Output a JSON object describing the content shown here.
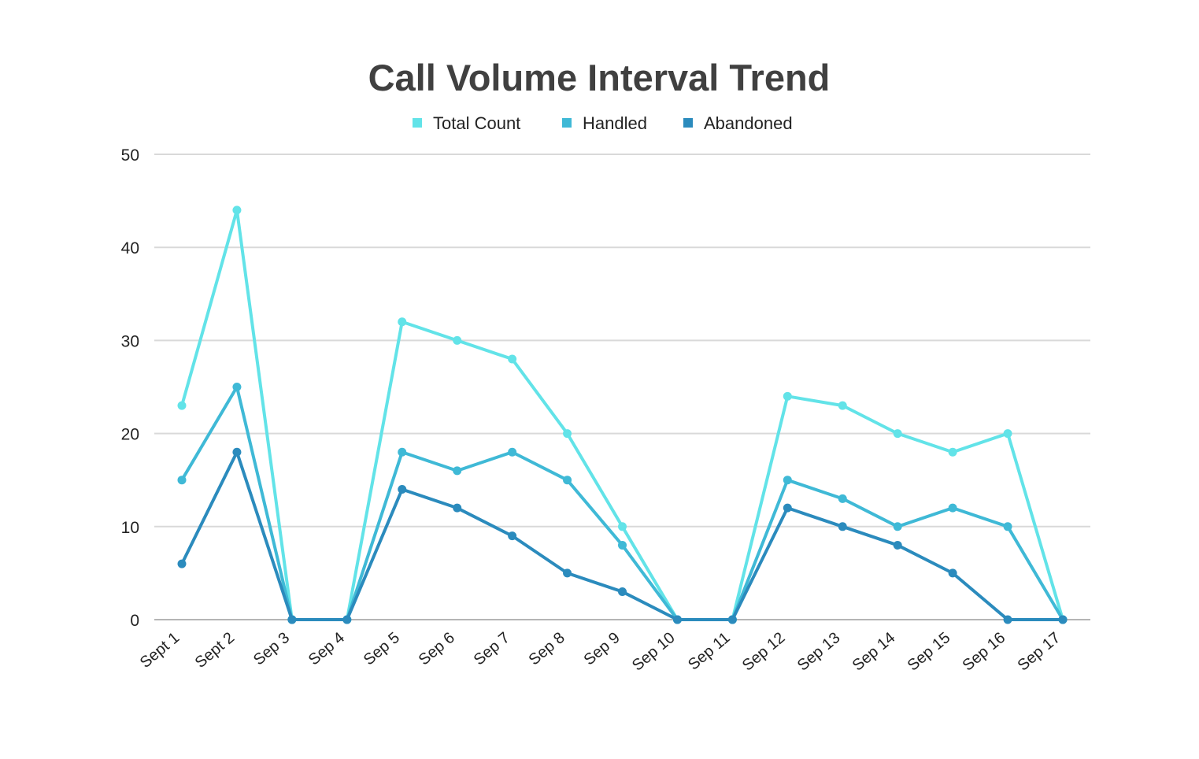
{
  "chart_data": {
    "type": "line",
    "title": "Call Volume Interval Trend",
    "xlabel": "",
    "ylabel": "",
    "ylim": [
      0,
      50
    ],
    "yticks": [
      0,
      10,
      20,
      30,
      40,
      50
    ],
    "grid": true,
    "legend_position": "top-center",
    "categories": [
      "Sept 1",
      "Sept 2",
      "Sep 3",
      "Sep 4",
      "Sep 5",
      "Sep 6",
      "Sep 7",
      "Sep 8",
      "Sep 9",
      "Sep 10",
      "Sep 11",
      "Sep 12",
      "Sep 13",
      "Sep 14",
      "Sep 15",
      "Sep 16",
      "Sep 17"
    ],
    "series": [
      {
        "name": "Total Count",
        "color": "#62e3e8",
        "values": [
          23,
          44,
          0,
          0,
          32,
          30,
          28,
          20,
          10,
          0,
          0,
          24,
          23,
          20,
          18,
          20,
          0
        ]
      },
      {
        "name": "Handled",
        "color": "#3fb9d6",
        "values": [
          15,
          25,
          0,
          0,
          18,
          16,
          18,
          15,
          8,
          0,
          0,
          15,
          13,
          10,
          12,
          10,
          0
        ]
      },
      {
        "name": "Abandoned",
        "color": "#2b8bbd",
        "values": [
          6,
          18,
          0,
          0,
          14,
          12,
          9,
          5,
          3,
          0,
          0,
          12,
          10,
          8,
          5,
          0,
          0
        ]
      }
    ]
  }
}
